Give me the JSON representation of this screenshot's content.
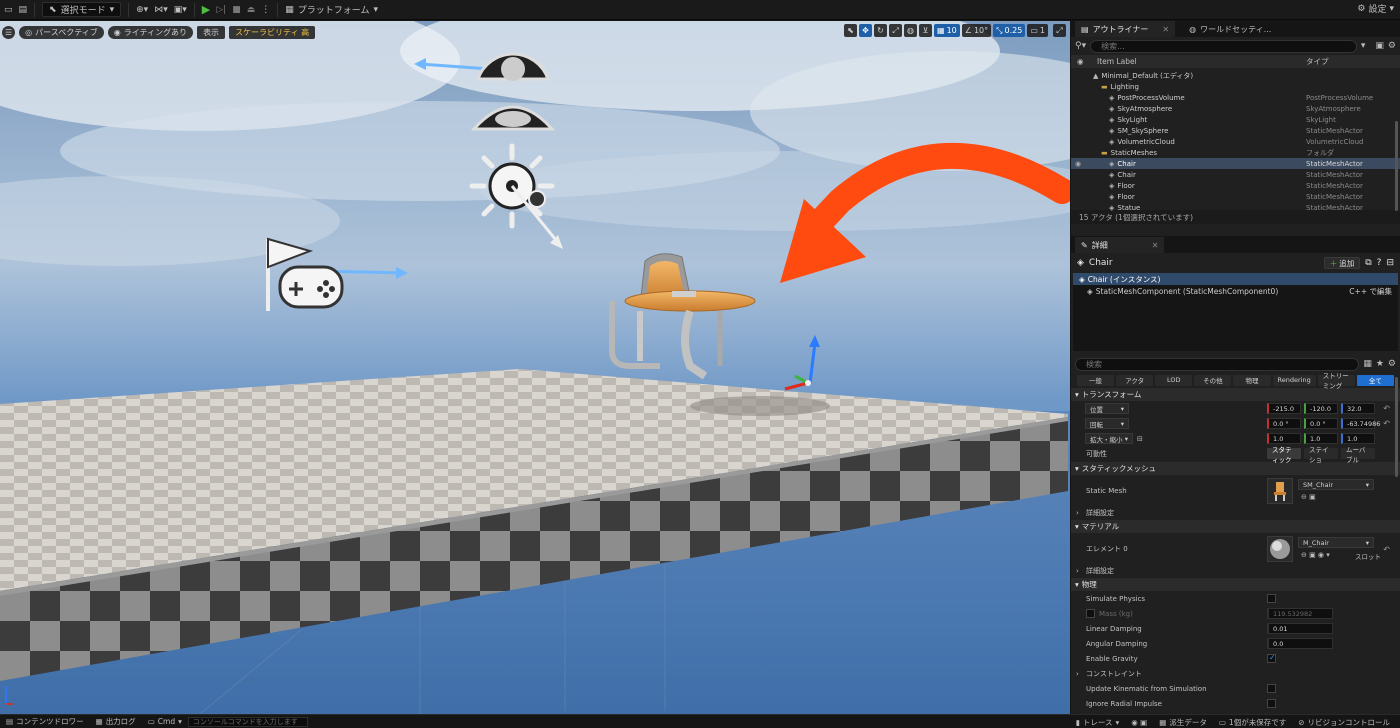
{
  "toolbar": {
    "mode_label": "選択モード",
    "platform_label": "プラットフォーム",
    "settings_label": "設定"
  },
  "viewport": {
    "perspective_label": "パースペクティブ",
    "lighting_label": "ライティングあり",
    "show_label": "表示",
    "scalability_label": "スケーラビリティ 高",
    "grid_snap": "10",
    "rotate_snap": "10°",
    "scale_snap": "0.25",
    "camera_speed": "1",
    "arrow_color": "#ff4a10"
  },
  "outliner": {
    "tab_label": "アウトライナー",
    "world_tab_label": "ワールドセッティ...",
    "search_placeholder": "検索...",
    "col_label": "Item Label",
    "col_type": "タイプ",
    "rows": [
      {
        "label": "Minimal_Default (エディタ)",
        "type": "",
        "indent": 1,
        "icon": "level"
      },
      {
        "label": "Lighting",
        "type": "",
        "indent": 2,
        "icon": "folder"
      },
      {
        "label": "PostProcessVolume",
        "type": "PostProcessVolume",
        "indent": 3,
        "icon": "mesh"
      },
      {
        "label": "SkyAtmosphere",
        "type": "SkyAtmosphere",
        "indent": 3,
        "icon": "mesh"
      },
      {
        "label": "SkyLight",
        "type": "SkyLight",
        "indent": 3,
        "icon": "mesh"
      },
      {
        "label": "SM_SkySphere",
        "type": "StaticMeshActor",
        "indent": 3,
        "icon": "mesh"
      },
      {
        "label": "VolumetricCloud",
        "type": "VolumetricCloud",
        "indent": 3,
        "icon": "mesh"
      },
      {
        "label": "StaticMeshes",
        "type": "フォルダ",
        "indent": 2,
        "icon": "folder"
      },
      {
        "label": "Chair",
        "type": "StaticMeshActor",
        "indent": 3,
        "icon": "mesh",
        "selected": true
      },
      {
        "label": "Chair",
        "type": "StaticMeshActor",
        "indent": 3,
        "icon": "mesh"
      },
      {
        "label": "Floor",
        "type": "StaticMeshActor",
        "indent": 3,
        "icon": "mesh"
      },
      {
        "label": "Floor",
        "type": "StaticMeshActor",
        "indent": 3,
        "icon": "mesh"
      },
      {
        "label": "Statue",
        "type": "StaticMeshActor",
        "indent": 3,
        "icon": "mesh"
      }
    ],
    "footer": "15 アクタ (1個選択されています)"
  },
  "details": {
    "tab_label": "詳細",
    "actor_name": "Chair",
    "add_label": "追加",
    "instance_label": "Chair (インスタンス)",
    "component_label": "StaticMeshComponent (StaticMeshComponent0)",
    "component_action": "C++ で編集",
    "search_placeholder": "検索",
    "filters": [
      "一般",
      "アクタ",
      "LOD",
      "その他",
      "物理",
      "Rendering",
      "ストリーミング",
      "全て"
    ],
    "transform_section": "トランスフォーム",
    "location_label": "位置",
    "location": [
      "-215.0",
      "-120.0",
      "32.0"
    ],
    "rotation_label": "回転",
    "rotation": [
      "0.0 °",
      "0.0 °",
      "-63.74986"
    ],
    "scale_label": "拡大・縮小",
    "scale": [
      "1.0",
      "1.0",
      "1.0"
    ],
    "mobility_label": "可動性",
    "mobility_options": [
      "スタティック",
      "ステイショ",
      "ムーバブル"
    ],
    "static_mesh_section": "スタティックメッシュ",
    "static_mesh_label": "Static Mesh",
    "static_mesh_value": "SM_Chair",
    "advanced_label": "詳細設定",
    "material_section": "マテリアル",
    "element_label": "エレメント 0",
    "material_value": "M_Chair",
    "slot_label": "スロット",
    "physics_section": "物理",
    "simulate_physics_label": "Simulate Physics",
    "mass_label": "Mass (kg)",
    "mass_value": "119.532982",
    "linear_damping_label": "Linear Damping",
    "linear_damping_value": "0.01",
    "angular_damping_label": "Angular Damping",
    "angular_damping_value": "0.0",
    "enable_gravity_label": "Enable Gravity",
    "constraints_label": "コンストレイント",
    "update_kinematic_label": "Update Kinematic from Simulation",
    "ignore_radial_label": "Ignore Radial Impulse"
  },
  "statusbar": {
    "content_drawer": "コンテンツドロワー",
    "output_log": "出力ログ",
    "cmd_label": "Cmd",
    "console_placeholder": "コンソールコマンドを入力します",
    "trace_label": "トレース",
    "derived_data_label": "派生データ",
    "unsaved_label": "1個が未保存です",
    "revision_label": "リビジョンコントロール"
  }
}
